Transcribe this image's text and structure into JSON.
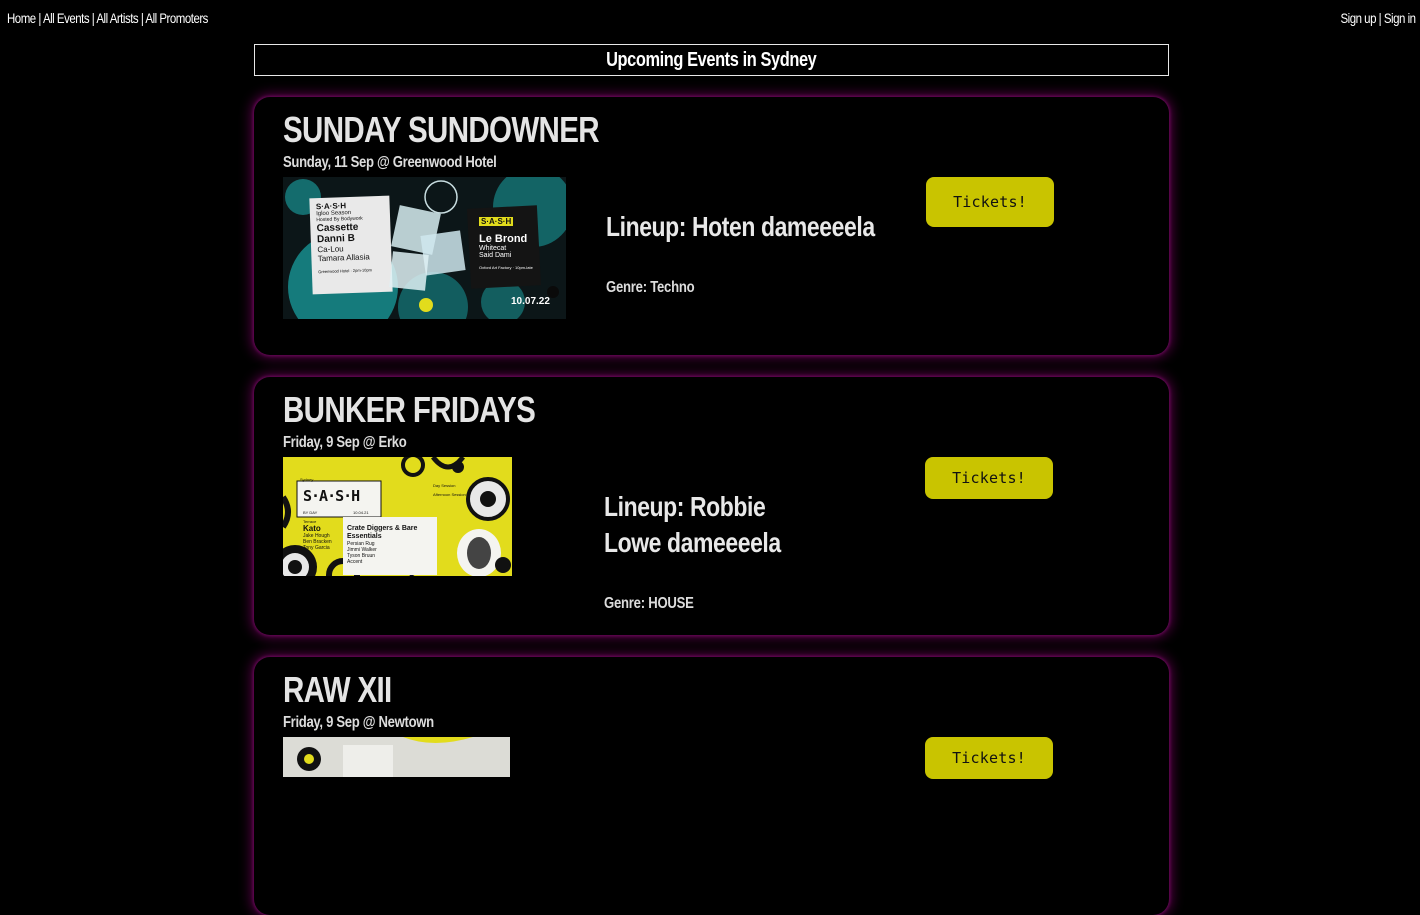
{
  "nav": {
    "left_links": [
      "Home",
      "All Events",
      "All Artists",
      "All Promoters"
    ],
    "right_links": [
      "Sign up",
      "Sign in"
    ],
    "separator": "|"
  },
  "page": {
    "heading": "Upcoming Events in Sydney"
  },
  "events": [
    {
      "title": "SUNDAY SUNDOWNER",
      "date_venue": "Sunday, 11 Sep @ Greenwood Hotel",
      "lineup": "Lineup: Hoten dameeeela",
      "genre": "Genre: Techno",
      "tickets_label": "Tickets!",
      "flyer": {
        "brand": "S·A·S·H",
        "by_day": "By Day",
        "by_night": "By Night",
        "season": "Igloo Season",
        "hosted_by": "Hosted By Bodywork",
        "bodywork": "BODYWORK",
        "artists_left": [
          "Cassette",
          "Danni B",
          "Ca-Lou",
          "Tamara Allasia"
        ],
        "left_venue": "Greenwood Hotel · 2pm-10pm",
        "headliner": "Le Brond",
        "artists_right": [
          "Whitecat",
          "Said Dami"
        ],
        "right_venue": "Oxford Art Factory · 10pm-late",
        "date": "10.07.22"
      }
    },
    {
      "title": "BUNKER FRIDAYS",
      "date_venue": "Friday, 9 Sep @ Erko",
      "lineup": "Lineup: Robbie Lowe dameeeela",
      "genre": "Genre: HOUSE",
      "tickets_label": "Tickets!",
      "flyer": {
        "city": "Sydney",
        "brand": "S·A·S·H",
        "by_day": "BY DAY",
        "date": "10.04.21",
        "terrace": "Terrace",
        "artists_left": [
          "Kato",
          "Jake Hough",
          "Ben Bracken",
          "Tony Garcia"
        ],
        "stage_right": "Crate Diggers & Bare Essentials",
        "artists_right": [
          "Persian Rug",
          "Jimmi Walker",
          "Tyson Bruun",
          "Accent"
        ],
        "right_info": [
          "Day Session",
          "Afternoon Session"
        ]
      }
    },
    {
      "title": "RAW XII",
      "date_venue": "Friday, 9 Sep @ Newtown",
      "tickets_label": "Tickets!"
    }
  ],
  "colors": {
    "background": "#000000",
    "ticket_button": "#c9c400",
    "card_glow": "#96007a",
    "flyer1_teal": "#1aa6a6",
    "flyer2_yellow": "#e2dc1c"
  }
}
